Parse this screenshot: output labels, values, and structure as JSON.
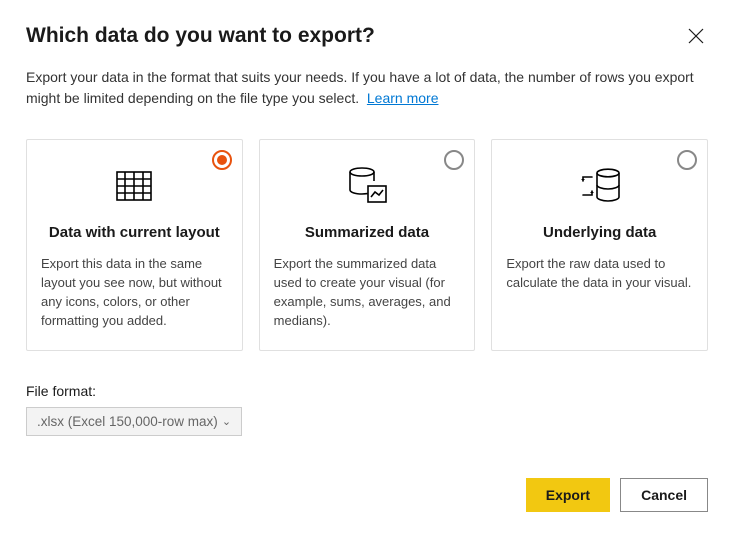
{
  "title": "Which data do you want to export?",
  "description": "Export your data in the format that suits your needs. If you have a lot of data, the number of rows you export might be limited depending on the file type you select.",
  "learn_more_label": "Learn more",
  "options": [
    {
      "title": "Data with current layout",
      "description": "Export this data in the same layout you see now, but without any icons, colors, or other formatting you added.",
      "selected": true
    },
    {
      "title": "Summarized data",
      "description": "Export the summarized data used to create your visual (for example, sums, averages, and medians).",
      "selected": false
    },
    {
      "title": "Underlying data",
      "description": "Export the raw data used to calculate the data in your visual.",
      "selected": false
    }
  ],
  "file_format": {
    "label": "File format:",
    "selected_value": ".xlsx (Excel 150,000-row max)"
  },
  "buttons": {
    "export": "Export",
    "cancel": "Cancel"
  }
}
